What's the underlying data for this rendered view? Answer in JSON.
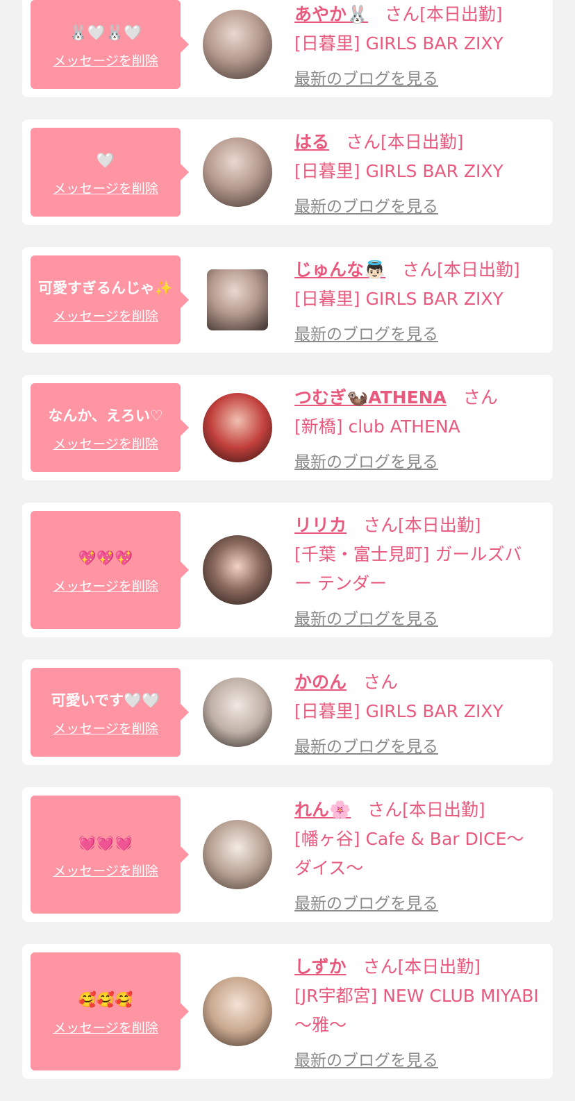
{
  "items": [
    {
      "message": "🐰🤍🐰🤍",
      "delete_label": "メッセージを削除",
      "name": "あやか🐰",
      "status": "さん[本日出勤]",
      "shop": "[日暮里] GIRLS BAR ZIXY",
      "blog_label": "最新のブログを見る"
    },
    {
      "message": "🤍",
      "delete_label": "メッセージを削除",
      "name": "はる",
      "status": "さん[本日出勤]",
      "shop": "[日暮里] GIRLS BAR ZIXY",
      "blog_label": "最新のブログを見る"
    },
    {
      "message": "可愛すぎるんじゃ✨",
      "delete_label": "メッセージを削除",
      "name": "じゅんな👼🏻",
      "status": "さん[本日出勤]",
      "shop": "[日暮里] GIRLS BAR ZIXY",
      "blog_label": "最新のブログを見る"
    },
    {
      "message": "なんか、えろい♡",
      "delete_label": "メッセージを削除",
      "name": "つむぎ🦦ATHENA",
      "status": "さん",
      "shop": "[新橋] club ATHENA",
      "blog_label": "最新のブログを見る"
    },
    {
      "message": "💖💖💖",
      "delete_label": "メッセージを削除",
      "name": "リリカ",
      "status": "さん[本日出勤]",
      "shop": "[千葉・富士見町] ガールズバー テンダー",
      "blog_label": "最新のブログを見る"
    },
    {
      "message": "可愛いです🤍🤍",
      "delete_label": "メッセージを削除",
      "name": "かのん",
      "status": "さん",
      "shop": "[日暮里] GIRLS BAR ZIXY",
      "blog_label": "最新のブログを見る"
    },
    {
      "message": "💓💓💓",
      "delete_label": "メッセージを削除",
      "name": "れん🌸",
      "status": "さん[本日出勤]",
      "shop": "[幡ヶ谷] Cafe & Bar DICE〜ダイス〜",
      "blog_label": "最新のブログを見る"
    },
    {
      "message": "🥰🥰🥰",
      "delete_label": "メッセージを削除",
      "name": "しずか",
      "status": "さん[本日出勤]",
      "shop": "[JR宇都宮] NEW CLUB MIYABI 〜雅〜",
      "blog_label": "最新のブログを見る"
    }
  ]
}
